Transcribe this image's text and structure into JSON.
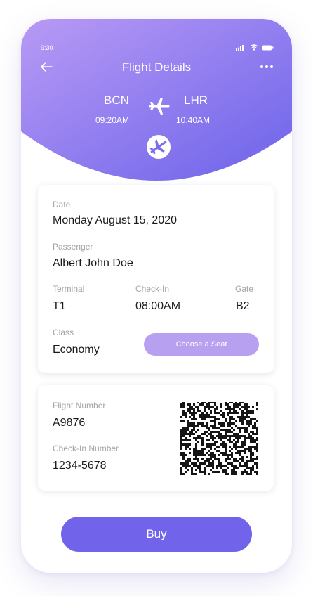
{
  "status_bar": {
    "time": "9:30",
    "icons": [
      "signal-icon",
      "wifi-icon",
      "battery-icon"
    ]
  },
  "header": {
    "title": "Flight Details",
    "back_icon": "arrow-left-icon",
    "menu_icon": "more-dots-icon"
  },
  "route": {
    "origin": {
      "code": "BCN",
      "time": "09:20AM"
    },
    "destination": {
      "code": "LHR",
      "time": "10:40AM"
    },
    "plane_icon": "airplane-icon",
    "badge_icon": "plane-circle-icon"
  },
  "details": {
    "date_label": "Date",
    "date_value": "Monday August 15, 2020",
    "passenger_label": "Passenger",
    "passenger_value": "Albert John Doe",
    "terminal_label": "Terminal",
    "terminal_value": "T1",
    "checkin_label": "Check-In",
    "checkin_value": "08:00AM",
    "gate_label": "Gate",
    "gate_value": "B2",
    "class_label": "Class",
    "class_value": "Economy",
    "seat_button": "Choose a Seat"
  },
  "ticket": {
    "flight_number_label": "Flight Number",
    "flight_number_value": "A9876",
    "checkin_number_label": "Check-In Number",
    "checkin_number_value": "1234-5678",
    "code_icon": "barcode-icon"
  },
  "actions": {
    "buy_label": "Buy"
  },
  "colors": {
    "gradient_start": "#b89af5",
    "gradient_end": "#6c63ea",
    "seat_button": "#b7a0f0",
    "buy_button": "#7164ea"
  }
}
